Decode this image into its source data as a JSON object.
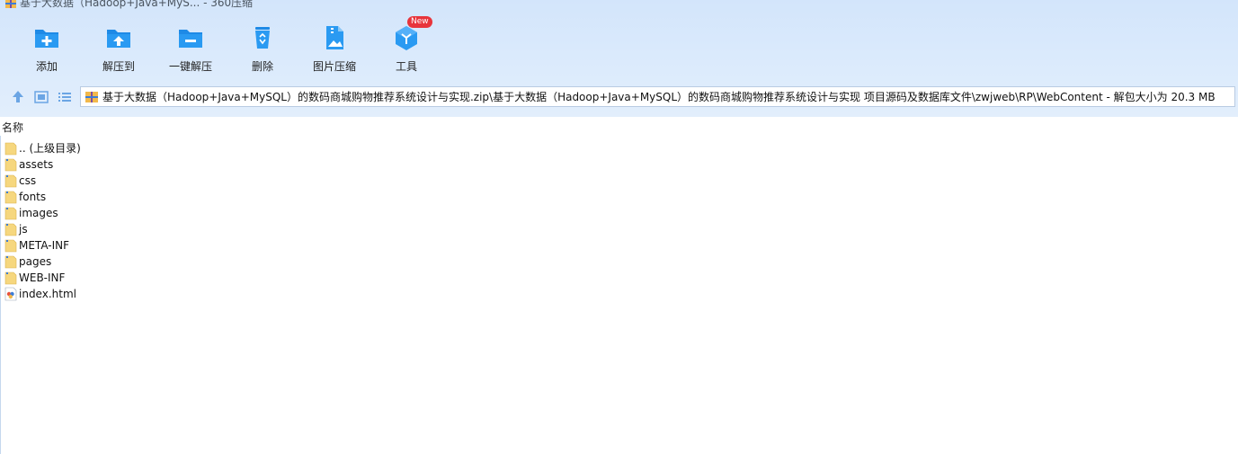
{
  "window": {
    "title": "基于大数据（Hadoop+Java+MyS... - 360压缩"
  },
  "toolbar": {
    "buttons": [
      {
        "label": "添加",
        "icon": "add-folder-icon"
      },
      {
        "label": "解压到",
        "icon": "extract-to-icon"
      },
      {
        "label": "一键解压",
        "icon": "one-click-extract-icon"
      },
      {
        "label": "删除",
        "icon": "recycle-delete-icon"
      },
      {
        "label": "图片压缩",
        "icon": "image-compress-icon"
      },
      {
        "label": "工具",
        "icon": "tools-cube-icon"
      }
    ],
    "new_badge": "New"
  },
  "address": {
    "path": "基于大数据（Hadoop+Java+MySQL）的数码商城购物推荐系统设计与实现.zip\\基于大数据（Hadoop+Java+MySQL）的数码商城购物推荐系统设计与实现 项目源码及数据库文件\\zwjweb\\RP\\WebContent - 解包大小为 20.3 MB"
  },
  "list": {
    "column_name": "名称",
    "items": [
      {
        "name": ".. (上级目录)",
        "type": "parent"
      },
      {
        "name": "assets",
        "type": "folder"
      },
      {
        "name": "css",
        "type": "folder"
      },
      {
        "name": "fonts",
        "type": "folder"
      },
      {
        "name": "images",
        "type": "folder"
      },
      {
        "name": "js",
        "type": "folder"
      },
      {
        "name": "META-INF",
        "type": "folder"
      },
      {
        "name": "pages",
        "type": "folder"
      },
      {
        "name": "WEB-INF",
        "type": "folder"
      },
      {
        "name": "index.html",
        "type": "html"
      }
    ]
  },
  "colors": {
    "accent": "#1e8ae6",
    "toolbar_bg": "#d3e5fb",
    "folder": "#f6d77e",
    "badge": "#e8343b"
  }
}
